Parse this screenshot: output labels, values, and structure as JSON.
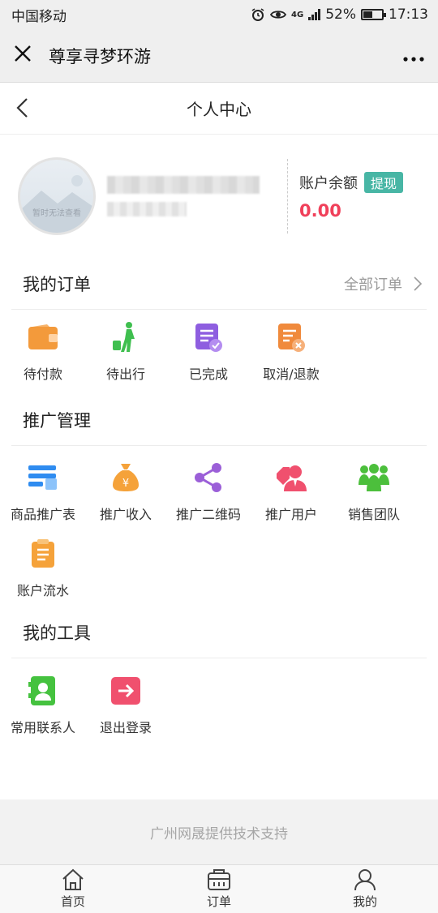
{
  "status": {
    "carrier": "中国移动",
    "battery": "52%",
    "battery_level": 0.52,
    "time": "17:13",
    "network": "4G"
  },
  "wx": {
    "title": "尊享寻梦环游",
    "close_icon": "close-icon",
    "more_icon": "more-icon"
  },
  "page": {
    "title": "个人中心"
  },
  "profile": {
    "avatar_text": "暂时无法查看",
    "balance_label": "账户余额",
    "withdraw_label": "提现",
    "balance_value": "0.00"
  },
  "orders": {
    "title": "我的订单",
    "all_label": "全部订单",
    "items": [
      {
        "label": "待付款",
        "icon": "wallet-icon",
        "color": "#f39a3b"
      },
      {
        "label": "待出行",
        "icon": "traveler-icon",
        "color": "#3fbf4f"
      },
      {
        "label": "已完成",
        "icon": "completed-icon",
        "color": "#8e5ee0"
      },
      {
        "label": "取消/退款",
        "icon": "refund-icon",
        "color": "#f08a3c"
      }
    ]
  },
  "promotion": {
    "title": "推广管理",
    "items": [
      {
        "label": "商品推广表",
        "icon": "product-list-icon",
        "color": "#2f8cf0"
      },
      {
        "label": "推广收入",
        "icon": "money-bag-icon",
        "color": "#f5a23a"
      },
      {
        "label": "推广二维码",
        "icon": "share-icon",
        "color": "#9b5fd8"
      },
      {
        "label": "推广用户",
        "icon": "user-tag-icon",
        "color": "#f0506e"
      },
      {
        "label": "销售团队",
        "icon": "team-icon",
        "color": "#4cbf3c"
      },
      {
        "label": "账户流水",
        "icon": "ledger-icon",
        "color": "#f5a23a"
      }
    ]
  },
  "tools": {
    "title": "我的工具",
    "items": [
      {
        "label": "常用联系人",
        "icon": "contacts-icon",
        "color": "#45c23f"
      },
      {
        "label": "退出登录",
        "icon": "logout-icon",
        "color": "#f0506e"
      }
    ]
  },
  "footer": {
    "text": "广州网晟提供技术支持"
  },
  "tabbar": [
    {
      "label": "首页",
      "icon": "home-icon"
    },
    {
      "label": "订单",
      "icon": "orders-icon"
    },
    {
      "label": "我的",
      "icon": "profile-icon"
    }
  ]
}
